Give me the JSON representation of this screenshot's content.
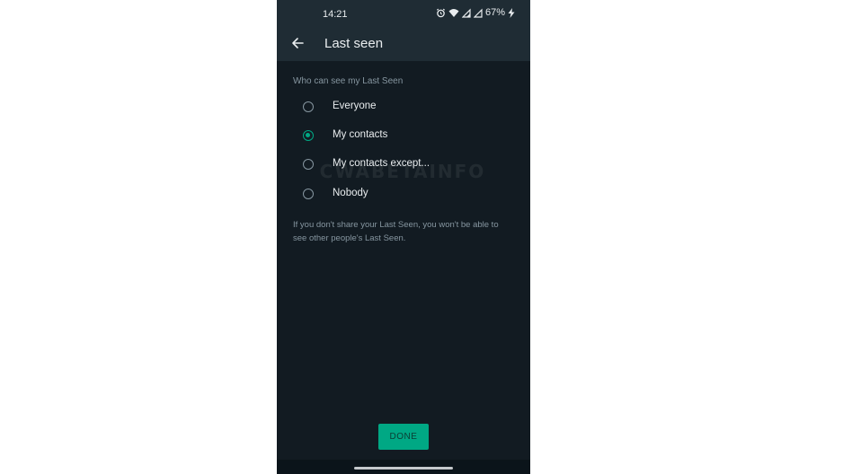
{
  "status_bar": {
    "time": "14:21",
    "battery": "67%",
    "icons": [
      "alarm-icon",
      "wifi-icon",
      "signal-icon",
      "signal-icon",
      "charging-icon"
    ]
  },
  "app_bar": {
    "back_icon": "arrow-left-icon",
    "title": "Last seen"
  },
  "section_header": "Who can see my Last Seen",
  "options": [
    {
      "label": "Everyone",
      "selected": false
    },
    {
      "label": "My contacts",
      "selected": true
    },
    {
      "label": "My contacts except...",
      "selected": false
    },
    {
      "label": "Nobody",
      "selected": false
    }
  ],
  "footnote": "If you don't share your Last Seen, you won't be able to see other people's Last Seen.",
  "watermark": "CWABETAINFO",
  "done_button": "DONE",
  "colors": {
    "accent": "#00a884",
    "background": "#121b22",
    "app_bar": "#1f2c34"
  }
}
